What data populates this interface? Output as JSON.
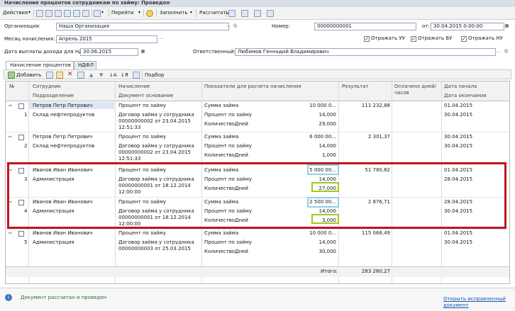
{
  "window": {
    "title": "Начисления процентов сотрудникам по займу: Проведен"
  },
  "toolbar": {
    "actions": "Действия",
    "goto": "Перейти",
    "fill": "Заполнить",
    "calculate": "Рассчитать"
  },
  "header": {
    "org_label": "Организация:",
    "org_value": "Наша Организация",
    "number_label": "Номер:",
    "number_value": "00000000001",
    "date_from_label": "от:",
    "date_value": "30.04.2015 0:00:00",
    "month_label": "Месяц начисления:",
    "month_value": "Апрель 2015",
    "reflect_uu": "Отражать УУ",
    "reflect_bu": "Отражать БУ",
    "reflect_nu": "Отражать НУ",
    "payout_label": "Дата выплаты дохода для НДФЛ:",
    "payout_value": "30.06.2015",
    "responsible_label": "Ответственный:",
    "responsible_value": "Любимов Геннадий Владимирович"
  },
  "tabs": [
    "Начисление процентов",
    "НДФЛ"
  ],
  "subtoolbar": {
    "add": "Добавить",
    "selection": "Подбор"
  },
  "grid": {
    "columns": {
      "no": "№",
      "employee": "Сотрудник",
      "department": "Подразделение",
      "accrual": "Начисление",
      "basis_doc": "Документ основание",
      "indicators": "Показатели для расчета начисления",
      "result": "Результат",
      "paid": "Оплачено дней/часов",
      "date_start": "Дата начала",
      "date_end": "Дата окончания"
    },
    "rows": [
      {
        "no": "1",
        "employee": "Петров Петр Петрович",
        "department": "Склад нефтепродуктов",
        "accrual": "Процент по займу",
        "doc1": "Договор займа у сотрудника",
        "doc2": "00000000002 от 23.04.2015",
        "doc3": "12:51:33",
        "ind1": "Сумма займа",
        "val1": "10 000 0...",
        "ind2": "Процент по займу",
        "val2": "14,000",
        "ind3": "КоличествоДней",
        "val3": "29,000",
        "result": "111 232,88",
        "date_start": "01.04.2015",
        "date_end": "30.04.2015"
      },
      {
        "no": "2",
        "employee": "Петров Петр Петрович",
        "department": "Склад нефтепродуктов",
        "accrual": "Процент по займу",
        "doc1": "Договор займа у сотрудника",
        "doc2": "00000000002 от 23.04.2015",
        "doc3": "12:51:33",
        "ind1": "Сумма займа",
        "val1": "6 000 00...",
        "ind2": "Процент по займу",
        "val2": "14,000",
        "ind3": "КоличествоДней",
        "val3": "1,000",
        "result": "2 301,37",
        "date_start": "30.04.2015",
        "date_end": "30.04.2015"
      },
      {
        "no": "3",
        "employee": "Иванов Иван Иванович",
        "department": "Администрация",
        "accrual": "Процент по займу",
        "doc1": "Договор займа у сотрудника",
        "doc2": "00000000001 от 18.12.2014",
        "doc3": "12:00:00",
        "ind1": "Сумма займа",
        "val1": "5 000 00...",
        "ind2": "Процент по займу",
        "val2": "14,000",
        "ind3": "КоличествоДней",
        "val3": "27,000",
        "result": "51 780,82",
        "date_start": "01.04.2015",
        "date_end": "28.04.2015"
      },
      {
        "no": "4",
        "employee": "Иванов Иван Иванович",
        "department": "Администрация",
        "accrual": "Процент по займу",
        "doc1": "Договор займа у сотрудника",
        "doc2": "00000000001 от 18.12.2014",
        "doc3": "12:00:00",
        "ind1": "Сумма займа",
        "val1": "2 500 00...",
        "ind2": "Процент по займу",
        "val2": "14,000",
        "ind3": "КоличествоДней",
        "val3": "3,000",
        "result": "2 876,71",
        "date_start": "28.04.2015",
        "date_end": "30.04.2015"
      },
      {
        "no": "5",
        "employee": "Иванов Иван Иванович",
        "department": "Администрация",
        "accrual": "Процент по займу",
        "doc1": "Договор займа у сотрудника",
        "doc2": "00000000003 от 25.03.2015",
        "doc3": "",
        "ind1": "Сумма займа",
        "val1": "10 000 0...",
        "ind2": "Процент по займу",
        "val2": "14,000",
        "ind3": "КоличествоДней",
        "val3": "30,000",
        "result": "115 068,49",
        "date_start": "01.04.2015",
        "date_end": "30.04.2015"
      }
    ],
    "total_label": "Итого:",
    "total_value": "283 260,27"
  },
  "status": {
    "message": "Документ рассчитан и проведен",
    "link1": "Открыть исправленный",
    "link2": "документ"
  }
}
